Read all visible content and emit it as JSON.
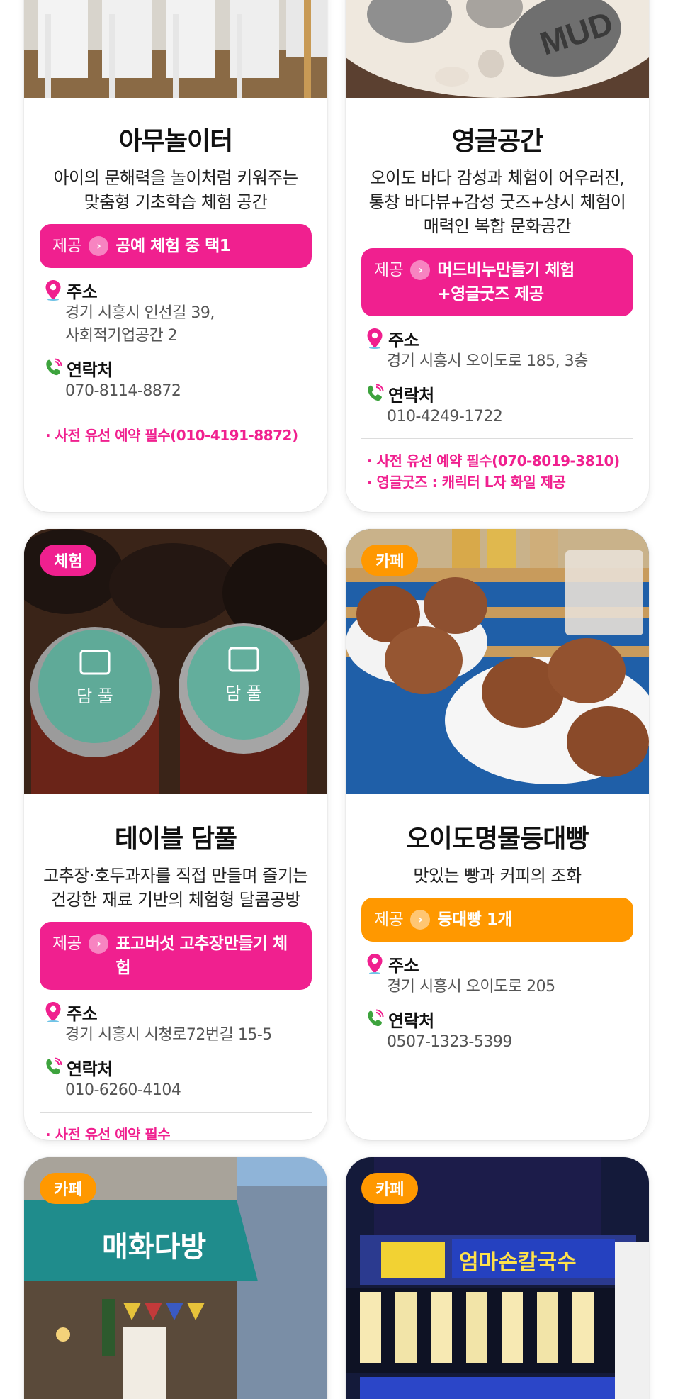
{
  "cards": [
    {
      "title": "아무놀이터",
      "desc_lines": [
        "아이의 문해력을 놀이처럼 키워주는",
        "맞춤형 기초학습 체험 공간"
      ],
      "offer": {
        "label": "제공",
        "text_lines": [
          "공예 체험 중 택1"
        ]
      },
      "address": {
        "label": "주소",
        "lines": [
          "경기 시흥시 인선길 39,",
          "사회적기업공간 2"
        ]
      },
      "contact": {
        "label": "연락처",
        "value": "070-8114-8872"
      },
      "notes": [
        "· 사전 유선 예약 필수(010-4191-8872)"
      ]
    },
    {
      "title": "영글공간",
      "desc_lines": [
        "오이도 바다 감성과 체험이 어우러진,",
        "통창 바다뷰+감성 굿즈+상시 체험이",
        "매력인 복합 문화공간"
      ],
      "offer": {
        "label": "제공",
        "text_lines": [
          "머드비누만들기 체험",
          "+영글굿즈 제공"
        ]
      },
      "address": {
        "label": "주소",
        "lines": [
          "경기 시흥시 오이도로 185, 3층"
        ]
      },
      "contact": {
        "label": "연락처",
        "value": "010-4249-1722"
      },
      "notes": [
        "· 사전 유선 예약 필수(070-8019-3810)",
        "· 영글굿즈 : 캐릭터 L자 화일 제공"
      ],
      "image_text": "MUD"
    },
    {
      "badge": "체험",
      "title": "테이블 담풀",
      "desc_lines": [
        "고추장·호두과자를 직접 만들며 즐기는",
        "건강한 재료 기반의 체험형 달콤공방"
      ],
      "offer": {
        "label": "제공",
        "text_lines": [
          "표고버섯 고추장만들기 체험"
        ]
      },
      "address": {
        "label": "주소",
        "lines": [
          "경기 시흥시 시청로72번길 15-5"
        ]
      },
      "contact": {
        "label": "연락처",
        "value": "010-6260-4104"
      },
      "notes": [
        "· 사전 유선 예약 필수"
      ],
      "image_text": "담 풀"
    },
    {
      "badge": "카페",
      "title": "오이도명물등대빵",
      "desc_lines": [
        "맛있는 빵과 커피의 조화"
      ],
      "offer": {
        "label": "제공",
        "text_lines": [
          "등대빵 1개"
        ]
      },
      "address": {
        "label": "주소",
        "lines": [
          "경기 시흥시 오이도로 205"
        ]
      },
      "contact": {
        "label": "연락처",
        "value": "0507-1323-5399"
      }
    },
    {
      "badge": "카페",
      "image_text": "매화다방"
    },
    {
      "badge": "카페",
      "image_text": "엄마손칼국수"
    }
  ],
  "colors": {
    "pink": "#f0208f",
    "orange": "#ff9800"
  },
  "icons": {
    "address": "location-pin-icon",
    "contact": "phone-icon",
    "offer": "chevron-right-icon"
  }
}
